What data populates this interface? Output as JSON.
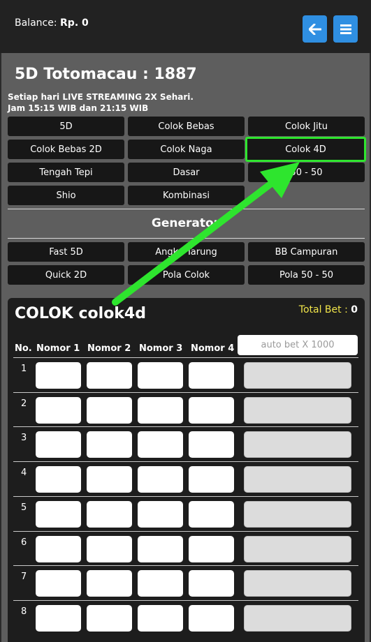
{
  "header": {
    "balance_label": "Balance:",
    "balance_value": "Rp. 0",
    "back_icon": "arrow-left-icon",
    "menu_icon": "hamburger-menu-icon",
    "accent_color": "#2f8fe2"
  },
  "market": {
    "title": "5D Totomacau : 1887",
    "info_line1": "Setiap hari LIVE STREAMING 2X Sehari.",
    "info_line2": "Jam 15:15 WIB dan 21:15 WIB"
  },
  "game_buttons": [
    "5D",
    "Colok Bebas",
    "Colok Jitu",
    "Colok Bebas 2D",
    "Colok Naga",
    "Colok 4D",
    "Tengah Tepi",
    "Dasar",
    "50 - 50",
    "Shio",
    "Kombinasi"
  ],
  "active_game": "Colok 4D",
  "highlight_color": "#2ee52e",
  "generator": {
    "title": "Generator",
    "buttons": [
      "Fast 5D",
      "Angka Tarung",
      "BB Campuran",
      "Quick 2D",
      "Pola Colok",
      "Pola 50 - 50"
    ]
  },
  "panel": {
    "title": "COLOK colok4d",
    "total_bet_label": "Total Bet :",
    "total_bet_value": "0",
    "columns": [
      "No.",
      "Nomor 1",
      "Nomor 2",
      "Nomor 3",
      "Nomor 4"
    ],
    "auto_bet_placeholder": "auto bet X 1000",
    "rows": [
      "1",
      "2",
      "3",
      "4",
      "5",
      "6",
      "7",
      "8"
    ]
  }
}
